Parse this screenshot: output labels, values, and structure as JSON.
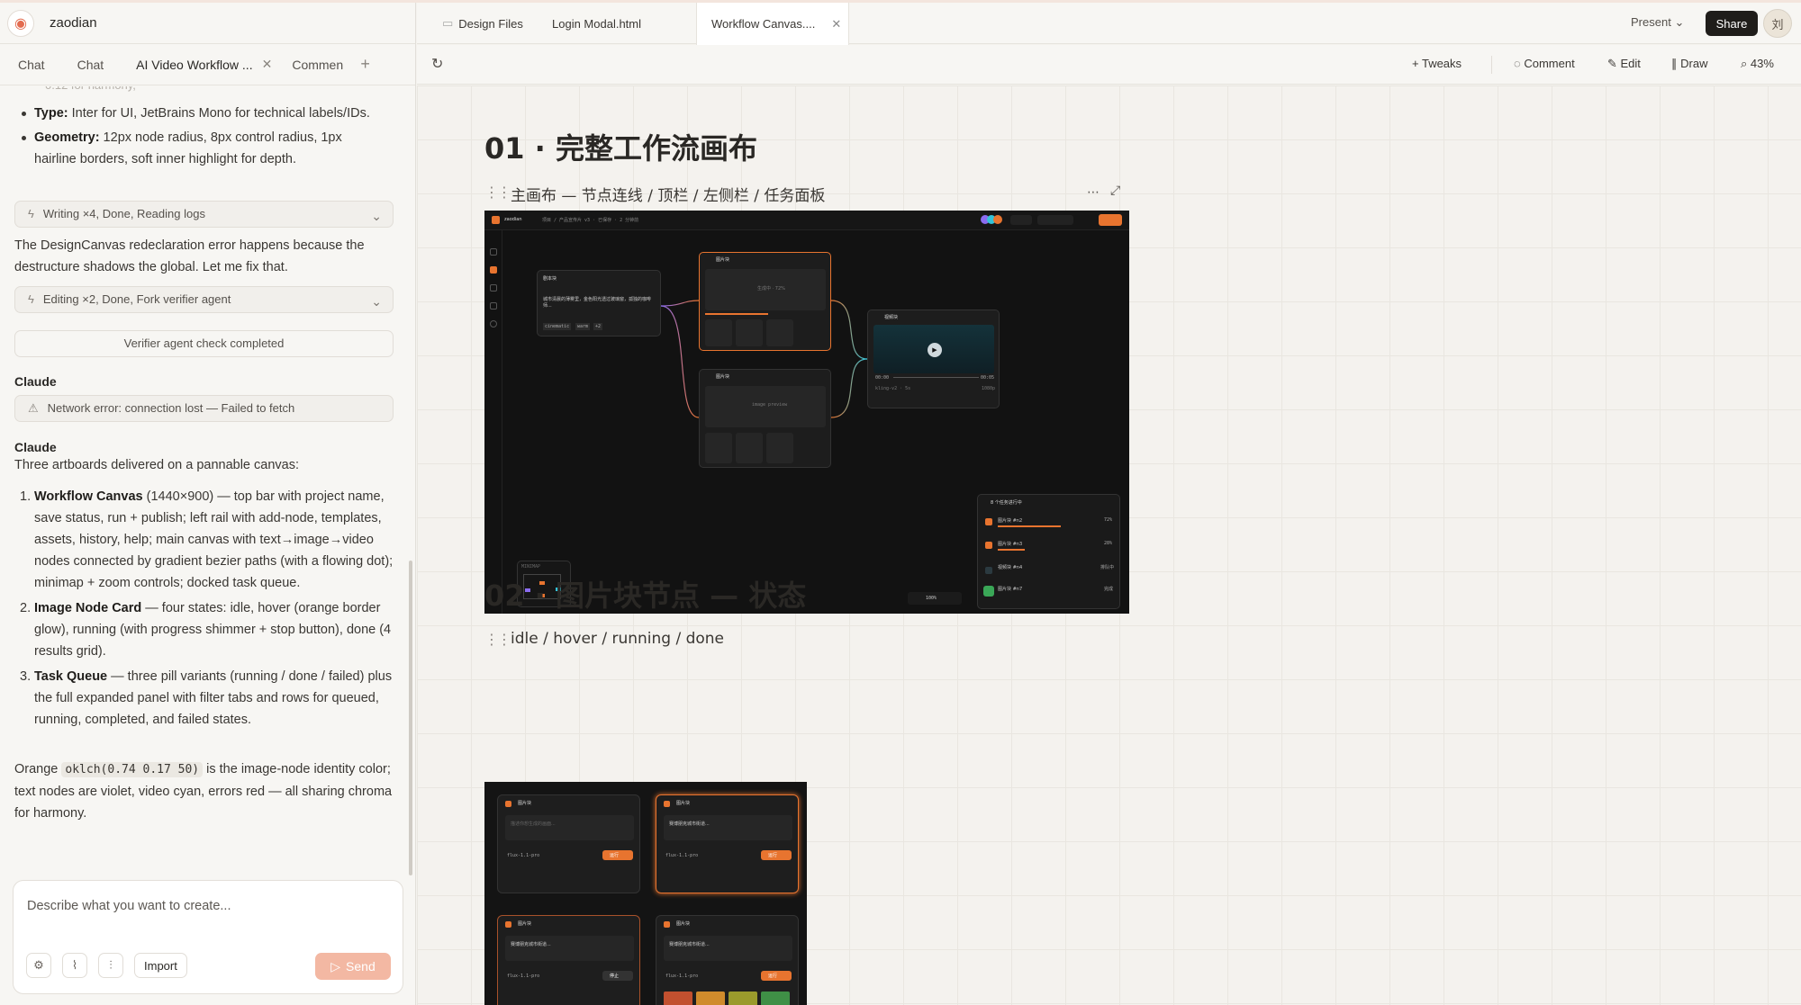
{
  "app": {
    "project_name": "zaodian"
  },
  "left_tabs": [
    "Chat",
    "Chat",
    "AI Video Workflow ...",
    "Commen"
  ],
  "chat": {
    "cut_line": "0.12 for harmony,",
    "bullets": [
      {
        "label": "Type:",
        "text": " Inter for UI, JetBrains Mono for technical labels/IDs."
      },
      {
        "label": "Geometry:",
        "text": " 12px node radius, 8px control radius, 1px hairline borders, soft inner highlight for depth."
      }
    ],
    "pill1": "Writing ×4, Done, Reading logs",
    "para1": "The DesignCanvas redeclaration error happens because the destructure shadows the global. Let me fix that.",
    "pill2": "Editing ×2, Done, Fork verifier agent",
    "verifier": "Verifier agent check completed",
    "claude1": "Claude",
    "error": "Network error: connection lost — Failed to fetch",
    "claude2": "Claude",
    "intro": "Three artboards delivered on a pannable canvas:",
    "items": [
      {
        "n": "1.",
        "label": "Workflow Canvas",
        "text": " (1440×900) — top bar with project name, save status, run + publish; left rail with add-node, templates, assets, history, help; main canvas with text→image→video nodes connected by gradient bezier paths (with a flowing dot); minimap + zoom controls; docked task queue."
      },
      {
        "n": "2.",
        "label": "Image Node Card",
        "text": " — four states: idle, hover (orange border glow), running (with progress shimmer + stop button), done (4 results grid)."
      },
      {
        "n": "3.",
        "label": "Task Queue",
        "text": " — three pill variants (running / done / failed) plus the full expanded panel with filter tabs and rows for queued, running, completed, and failed states."
      }
    ],
    "closing_pre": "Orange ",
    "closing_code": "oklch(0.74 0.17 50)",
    "closing_post": " is the image-node identity color; text nodes are violet, video cyan, errors red — all sharing chroma for harmony."
  },
  "composer": {
    "placeholder": "Describe what you want to create...",
    "import": "Import",
    "send": "Send"
  },
  "file_tabs": [
    "Design Files",
    "Login Modal.html",
    "Workflow Canvas...."
  ],
  "topbar": {
    "present": "Present",
    "share": "Share",
    "avatar": "刘"
  },
  "toolbar": {
    "tweaks": "Tweaks",
    "comment": "Comment",
    "edit": "Edit",
    "draw": "Draw",
    "zoom": "43%"
  },
  "canvas": {
    "section1": {
      "title": "01 · 完整工作流画布",
      "subtitle": "主画布 — 节点连线 / 顶栏 / 左侧栏 / 任务面板"
    },
    "section2": {
      "title": "02 · 图片块节点 — 状态",
      "subtitle": "idle / hover / running / done"
    }
  },
  "artboard1": {
    "project": "zaodian",
    "crumb": "项目 / 产品宣传片 v3 · 已保存 · 2 分钟前",
    "nodes": {
      "text": {
        "title": "剧本块",
        "body": "城市清晨的薄雾里，金色阳光透过玻璃窗，孤独的咖啡师...",
        "tags": [
          "cinematic",
          "warm",
          "+2"
        ]
      },
      "image1": {
        "title": "图片块",
        "status": "生成中 · 72%"
      },
      "image2": {
        "title": "图片块",
        "status": "image preview"
      },
      "video": {
        "title": "视频块",
        "time_start": "00:00",
        "time_end": "00:05",
        "model": "kling-v2 · 5s",
        "res": "1080p"
      }
    },
    "tasks": {
      "title": "8 个任务进行中",
      "rows": [
        {
          "name": "图片块 #n2",
          "value": "72%"
        },
        {
          "name": "图片块 #n3",
          "value": "28%"
        },
        {
          "name": "视频块 #n4",
          "value": "排队中"
        },
        {
          "name": "图片块 #n7",
          "value": "完成"
        }
      ]
    },
    "minimap": "MINIMAP",
    "zoom": "100%"
  },
  "artboard2": {
    "cards": [
      {
        "title": "图片块",
        "placeholder": "描述你想生成的画面...",
        "model": "flux-1.1-pro",
        "run": "运行",
        "state": "idle"
      },
      {
        "title": "图片块",
        "placeholder": "赛博朋克城市街道...",
        "model": "flux-1.1-pro",
        "run": "运行",
        "state": "hover"
      },
      {
        "title": "图片块",
        "placeholder": "赛博朋克城市街道...",
        "model": "flux-1.1-pro",
        "run": "停止",
        "state": "running"
      },
      {
        "title": "图片块",
        "placeholder": "赛博朋克城市街道...",
        "model": "flux-1.1-pro",
        "run": "运行",
        "state": "done"
      }
    ]
  },
  "colors": {
    "accent": "#e8742f",
    "text_node": "#8b6cf0",
    "video_node": "#34c3d8",
    "send_disabled": "#f3b8a3"
  }
}
